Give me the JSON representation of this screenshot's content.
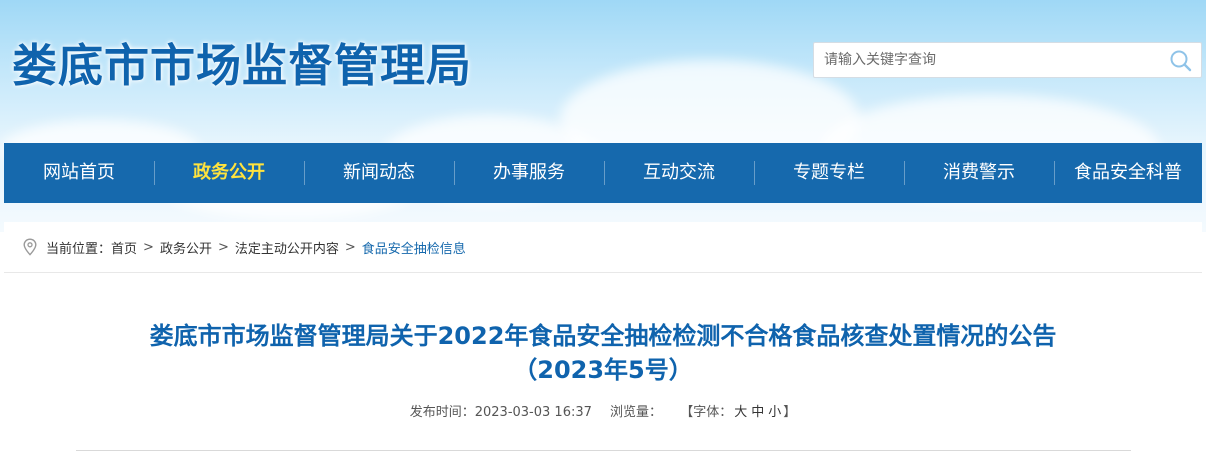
{
  "header": {
    "site_title": "娄底市市场监督管理局",
    "search": {
      "placeholder": "请输入关键字查询"
    }
  },
  "nav": {
    "items": [
      {
        "label": "网站首页"
      },
      {
        "label": "政务公开",
        "active": true
      },
      {
        "label": "新闻动态"
      },
      {
        "label": "办事服务"
      },
      {
        "label": "互动交流"
      },
      {
        "label": "专题专栏"
      },
      {
        "label": "消费警示"
      },
      {
        "label": "食品安全科普"
      }
    ],
    "background": "#1669ad",
    "active_color": "#ffe33d"
  },
  "breadcrumb": {
    "prefix": "当前位置：",
    "items": [
      {
        "label": "首页"
      },
      {
        "label": "政务公开"
      },
      {
        "label": "法定主动公开内容"
      },
      {
        "label": "食品安全抽检信息"
      }
    ],
    "separator": ">"
  },
  "article": {
    "title_line1": "娄底市市场监督管理局关于2022年食品安全抽检检测不合格食品核查处置情况的公告",
    "title_line2": "（2023年5号）",
    "publish_label": "发布时间：",
    "publish_time": "2023-03-03 16:37",
    "views_label": "浏览量：",
    "font_size": {
      "open": "【字体：",
      "large": "大",
      "medium": "中",
      "small": "小",
      "close": "】"
    }
  },
  "colors": {
    "title_blue": "#0f63ad",
    "link_blue": "#1669ad"
  },
  "icons": {
    "search": "search-icon",
    "location": "location-pin-icon"
  }
}
